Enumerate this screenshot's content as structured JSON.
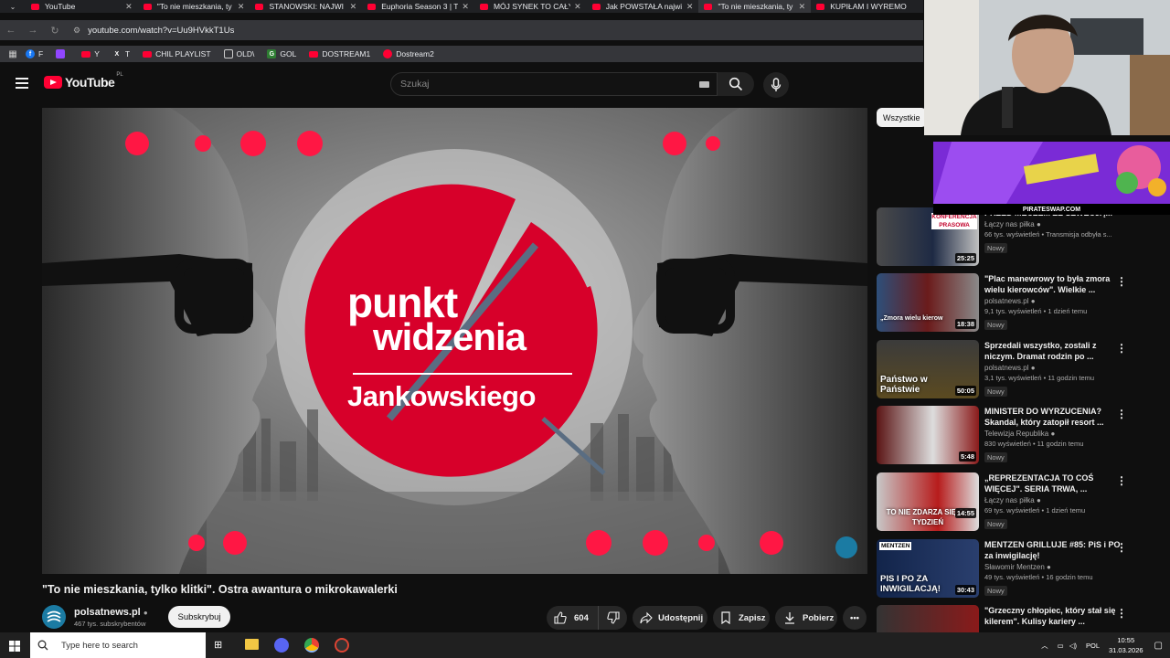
{
  "browser": {
    "tabs": [
      {
        "label": "YouTube"
      },
      {
        "label": "\"To nie mieszkania, ty"
      },
      {
        "label": "STANOWSKI: NAJWI"
      },
      {
        "label": "Euphoria Season 3 | T"
      },
      {
        "label": "MÓJ SYNEK TO CAŁY"
      },
      {
        "label": "Jak POWSTAŁA najwi"
      },
      {
        "label": "\"To nie mieszkania, ty"
      },
      {
        "label": "KUPIŁAM I WYREMO"
      }
    ],
    "url": "youtube.com/watch?v=Uu9HVkkT1Us",
    "bookmarks": [
      {
        "label": "F"
      },
      {
        "label": ""
      },
      {
        "label": "Y"
      },
      {
        "label": "T"
      },
      {
        "label": "CHIL PLAYLIST"
      },
      {
        "label": "OLD\\"
      },
      {
        "label": "GOL"
      },
      {
        "label": "DOSTREAM1"
      },
      {
        "label": "Dostream2"
      }
    ]
  },
  "header": {
    "logo_text": "YouTube",
    "logo_region": "PL",
    "search_placeholder": "Szukaj"
  },
  "video": {
    "thumbnail_text_line1": "punkt",
    "thumbnail_text_line2": "widzenia",
    "thumbnail_text_line3": "Jankowskiego",
    "title": "\"To nie mieszkania, tylko klitki\". Ostra awantura o mikrokawalerki",
    "channel_name": "polsatnews.pl",
    "channel_subs": "467 tys. subskrybentów",
    "subscribe_label": "Subskrybuj",
    "likes": "604",
    "share_label": "Udostępnij",
    "save_label": "Zapisz",
    "download_label": "Pobierz"
  },
  "sidebar": {
    "filter_chip": "Wszystkie",
    "ad_domain": "PIRATESWAP.COM",
    "recommendations": [
      {
        "title": "PRZED MECZEM ZE SZWECJĄ...",
        "channel": "Łączy nas piłka",
        "meta": "66 tys. wyświetleń • Transmisja odbyła s...",
        "badge": "Nowy",
        "duration": "25:25",
        "thumb_caption": "KONFERENCJA PRASOWA"
      },
      {
        "title": "\"Plac manewrowy to była zmora wielu kierowców\". Wielkie ...",
        "channel": "polsatnews.pl",
        "meta": "9,1 tys. wyświetleń • 1 dzień temu",
        "badge": "Nowy",
        "duration": "18:38",
        "thumb_caption": "„Zmora wielu kierow"
      },
      {
        "title": "Sprzedali wszystko, zostali z niczym. Dramat rodzin po ...",
        "channel": "polsatnews.pl",
        "meta": "3,1 tys. wyświetleń • 11 godzin temu",
        "badge": "Nowy",
        "duration": "50:05",
        "thumb_caption": "Państwo w Państwie"
      },
      {
        "title": "MINISTER DO WYRZUCENIA? Skandal, który zatopił resort ...",
        "channel": "Telewizja Republika",
        "meta": "830 wyświetleń • 11 godzin temu",
        "badge": "Nowy",
        "duration": "5:48",
        "thumb_caption": ""
      },
      {
        "title": "„REPREZENTACJA TO COŚ WIĘCEJ\". SERIA TRWA, ...",
        "channel": "Łączy nas piłka",
        "meta": "69 tys. wyświetleń • 1 dzień temu",
        "badge": "Nowy",
        "duration": "14:55",
        "thumb_caption": "TO NIE ZDARZA SIĘ CO TYDZIEŃ"
      },
      {
        "title": "MENTZEN GRILLUJE #85: PiS i PO za inwigilację!",
        "channel": "Sławomir Mentzen",
        "meta": "49 tys. wyświetleń • 16 godzin temu",
        "badge": "Nowy",
        "duration": "30:43",
        "thumb_caption": "PIS I PO ZA INWIGILACJĄ!"
      },
      {
        "title": "\"Grzeczny chłopiec, który stał się kilerem\". Kulisy kariery ...",
        "channel": "",
        "meta": "",
        "badge": "",
        "duration": "",
        "thumb_caption": ""
      }
    ]
  },
  "taskbar": {
    "search_placeholder": "Type here to search",
    "lang": "POL",
    "time": "10:55",
    "date": "31.03.2026"
  },
  "colors": {
    "yt_red": "#ff0033",
    "bg": "#0f0f0f",
    "accent_red": "#d7002a"
  }
}
